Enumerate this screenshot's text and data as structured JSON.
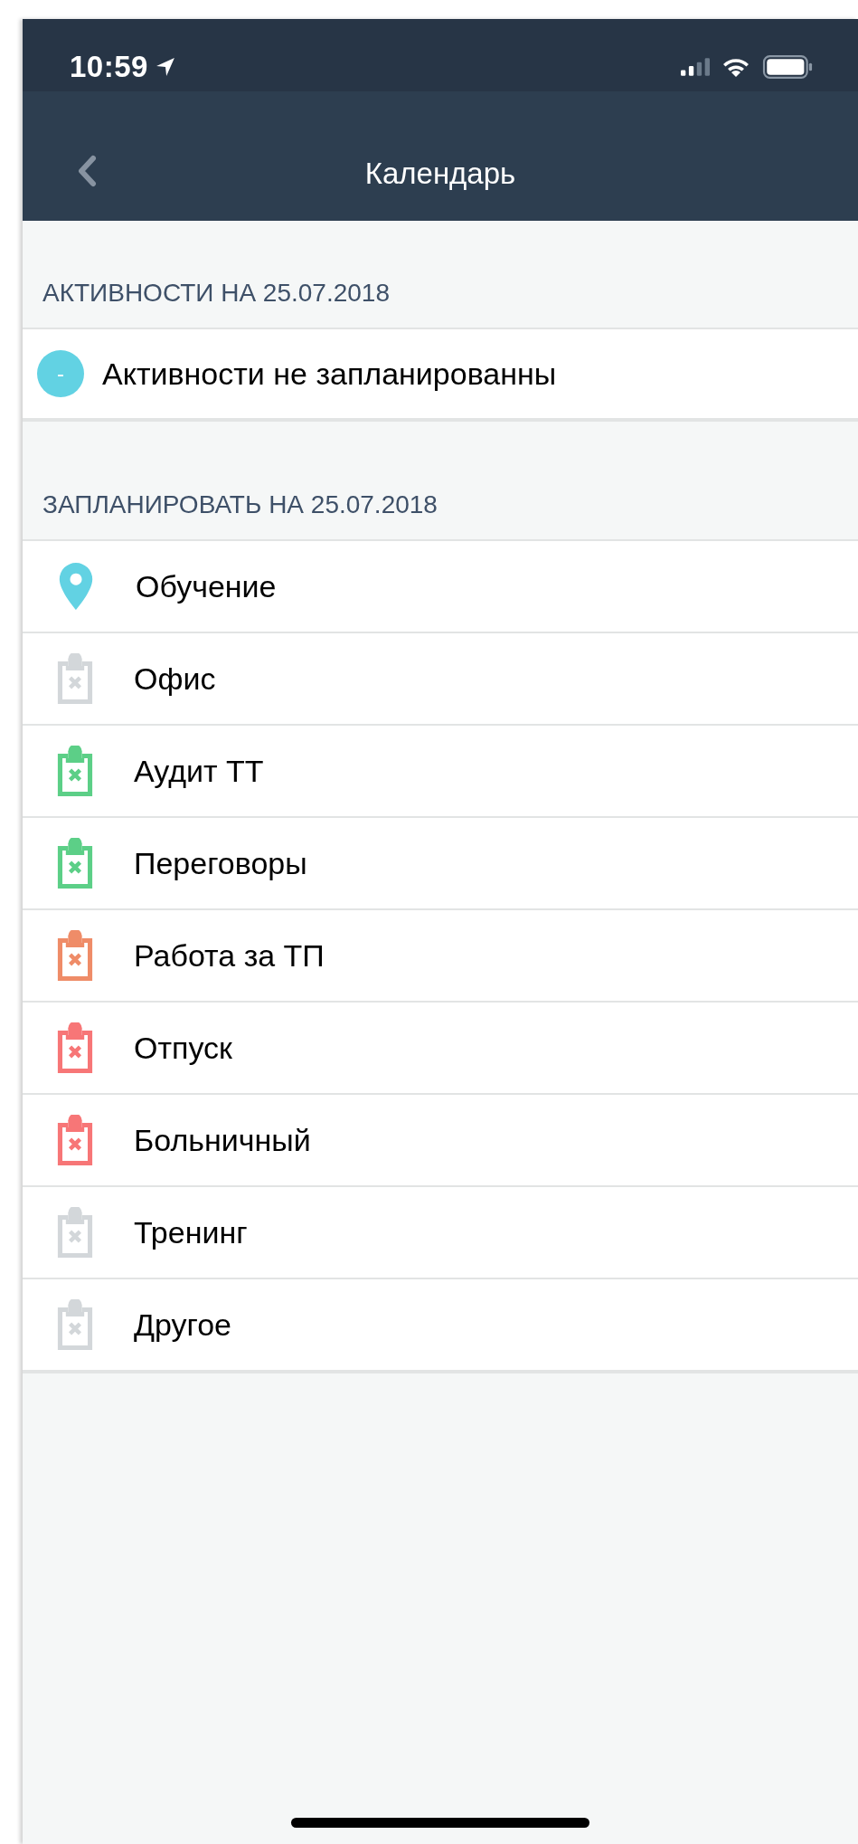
{
  "status_bar": {
    "time": "10:59"
  },
  "nav": {
    "title": "Календарь"
  },
  "sections": [
    {
      "header": "АКТИВНОСТИ НА 25.07.2018",
      "items": [
        {
          "kind": "badge",
          "mark": "-",
          "label": "Активности не запланированны",
          "color": "#62d2e3"
        }
      ]
    },
    {
      "header": "ЗАПЛАНИРОВАТЬ НА 25.07.2018",
      "items": [
        {
          "kind": "pin",
          "label": "Обучение",
          "color": "#62d2e3"
        },
        {
          "kind": "clipboard",
          "label": "Офис",
          "color": "#d3d7da"
        },
        {
          "kind": "clipboard",
          "label": "Аудит ТТ",
          "color": "#5ccf87"
        },
        {
          "kind": "clipboard",
          "label": "Переговоры",
          "color": "#5ccf87"
        },
        {
          "kind": "clipboard",
          "label": "Работа за ТП",
          "color": "#ef8c68"
        },
        {
          "kind": "clipboard",
          "label": "Отпуск",
          "color": "#f77677"
        },
        {
          "kind": "clipboard",
          "label": "Больничный",
          "color": "#f77677"
        },
        {
          "kind": "clipboard",
          "label": "Тренинг",
          "color": "#d3d7da"
        },
        {
          "kind": "clipboard",
          "label": "Другое",
          "color": "#d3d7da"
        }
      ]
    }
  ]
}
